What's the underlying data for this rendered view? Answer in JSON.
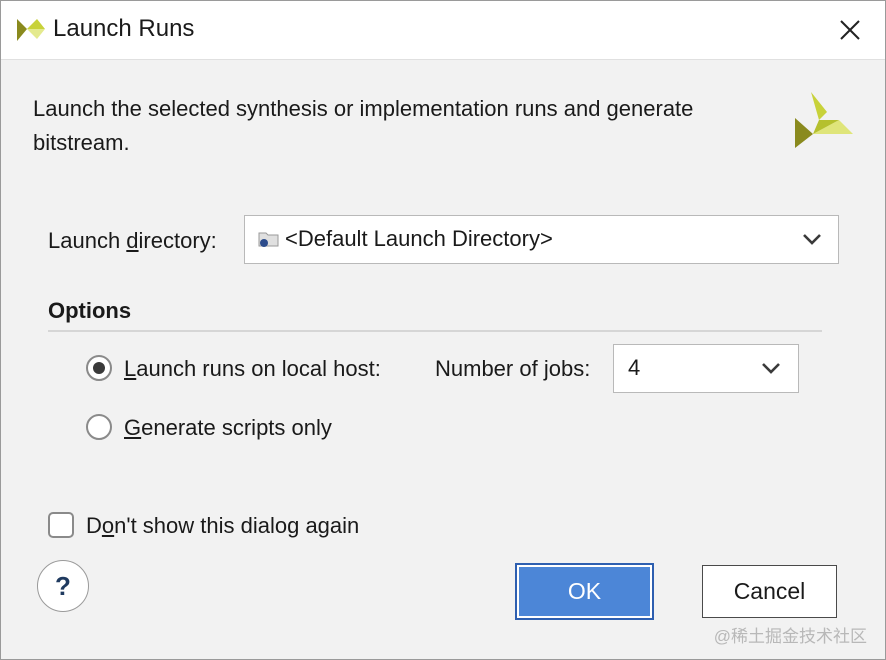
{
  "window": {
    "title": "Launch Runs",
    "logo_icon": "xilinx-logo-icon",
    "close_icon": "close-icon"
  },
  "description": "Launch the selected synthesis or implementation runs and generate bitstream.",
  "launch_directory": {
    "label_pre": "Launch ",
    "label_mnemonic": "d",
    "label_post": "irectory:",
    "value": "<Default Launch Directory>",
    "folder_icon": "folder-icon",
    "chevron_icon": "chevron-down-icon"
  },
  "options": {
    "title": "Options",
    "local_host": {
      "mnemonic": "L",
      "label_rest": "aunch runs on local host:",
      "selected": true
    },
    "jobs": {
      "label_pre": "Number of ",
      "label_mnemonic": "j",
      "label_post": "obs:",
      "value": "4"
    },
    "scripts_only": {
      "mnemonic": "G",
      "label_rest": "enerate scripts only",
      "selected": false
    }
  },
  "dont_show": {
    "label_pre": "D",
    "label_mnemonic": "o",
    "label_post": "n't show this dialog again",
    "checked": false
  },
  "buttons": {
    "help": "?",
    "ok": "OK",
    "cancel": "Cancel"
  },
  "watermark": "@稀土掘金技术社区",
  "colors": {
    "ok_button": "#4c86d7",
    "logo_dark": "#8a8a1e",
    "logo_light": "#c8d23a"
  }
}
